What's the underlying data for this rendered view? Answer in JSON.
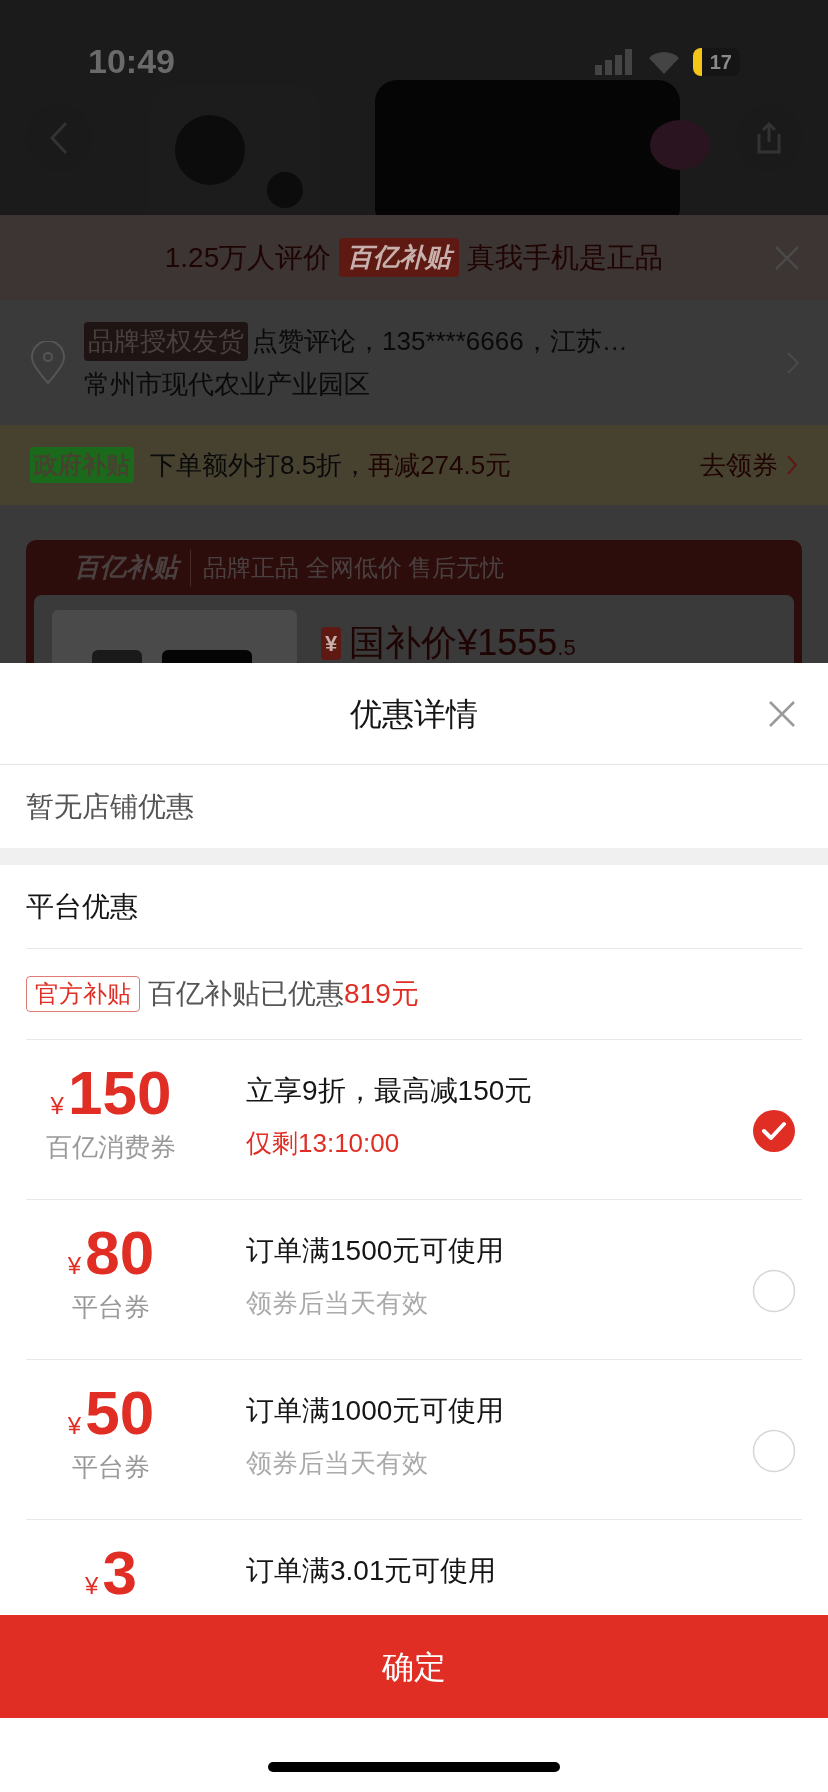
{
  "status_bar": {
    "time": "10:49",
    "battery": "17"
  },
  "review_banner": {
    "count_text": "1.25万人评价",
    "badge": "百亿补贴",
    "slogan": "真我手机是正品"
  },
  "address": {
    "badge": "品牌授权发货",
    "line1": "点赞评论，135****6666，江苏…",
    "line2": "常州市现代农业产业园区"
  },
  "gov_subsidy": {
    "badge": "政府补贴",
    "text": "下单额外打8.5折，",
    "highlight": "再减274.5元",
    "action": "去领券"
  },
  "subsidy_card": {
    "logo": "百亿补贴",
    "slogans": "品牌正品 全网低价 售后无忧",
    "price_icon": "¥",
    "price_label": "国补价¥1555",
    "price_decimal": ".5"
  },
  "sheet": {
    "title": "优惠详情",
    "shop_discount": "暂无店铺优惠",
    "platform_heading": "平台优惠",
    "official": {
      "tag": "官方补贴",
      "text": "百亿补贴已优惠",
      "amount": "819元"
    },
    "coupons": [
      {
        "currency": "¥",
        "amount": "150",
        "name": "百亿消费券",
        "title": "立享9折，最高减150元",
        "note": "仅剩13:10:00",
        "note_urgent": true,
        "selected": true
      },
      {
        "currency": "¥",
        "amount": "80",
        "name": "平台券",
        "title": "订单满1500元可使用",
        "note": "领券后当天有效",
        "note_urgent": false,
        "selected": false
      },
      {
        "currency": "¥",
        "amount": "50",
        "name": "平台券",
        "title": "订单满1000元可使用",
        "note": "领券后当天有效",
        "note_urgent": false,
        "selected": false
      },
      {
        "currency": "¥",
        "amount": "3",
        "title": "订单满3.01元可使用"
      }
    ],
    "confirm": "确定"
  }
}
